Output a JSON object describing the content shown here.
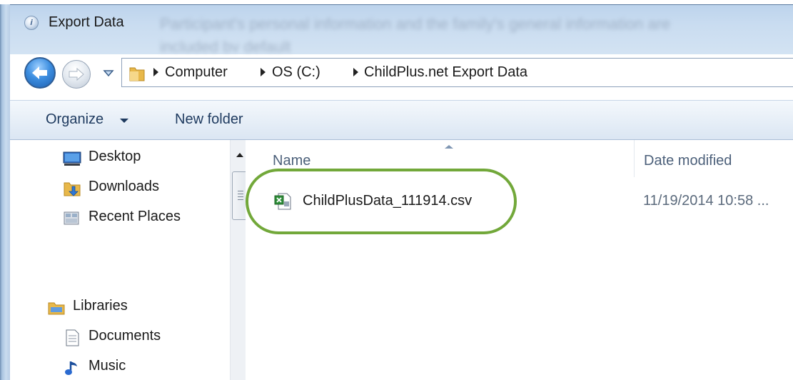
{
  "window": {
    "title": "Export Data",
    "background_text": "Participant's personal information and the family's general information are included by default"
  },
  "address_bar": {
    "crumbs": [
      "Computer",
      "OS (C:)",
      "ChildPlus.net Export Data"
    ]
  },
  "toolbar": {
    "organize_label": "Organize",
    "new_folder_label": "New folder"
  },
  "nav_pane": {
    "favorites": [
      {
        "label": "Desktop",
        "icon": "desktop-icon"
      },
      {
        "label": "Downloads",
        "icon": "downloads-folder-icon"
      },
      {
        "label": "Recent Places",
        "icon": "recent-places-icon"
      }
    ],
    "libraries": {
      "label": "Libraries",
      "icon": "libraries-icon",
      "items": [
        {
          "label": "Documents",
          "icon": "documents-icon"
        },
        {
          "label": "Music",
          "icon": "music-icon"
        }
      ]
    }
  },
  "file_list": {
    "columns": {
      "name": "Name",
      "date_modified": "Date modified"
    },
    "files": [
      {
        "name": "ChildPlusData_111914.csv",
        "date_modified": "11/19/2014 10:58 ...",
        "icon": "csv-file-icon"
      }
    ],
    "highlight_color": "#72a83a"
  }
}
